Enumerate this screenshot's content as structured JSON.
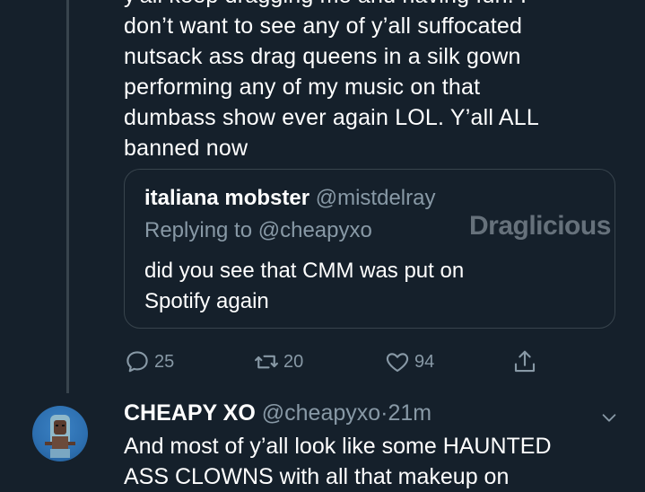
{
  "tweet": {
    "lines": [
      "y'all keep dragging me and having fun. I",
      "don’t want to see any of y’all suffocated",
      "nutsack ass drag queens in a silk gown",
      "performing any of my music on that",
      "dumbass show ever again LOL. Y’all ALL",
      "banned now"
    ],
    "quoted": {
      "name": "italiana mobster",
      "handle": "@mistdelray",
      "replying": "Replying to @cheapyxo",
      "lines": [
        "did you see that CMM was put on",
        "Spotify again"
      ]
    },
    "watermark": "Draglicious",
    "actions": {
      "replies": "25",
      "retweets": "20",
      "likes": "94"
    }
  },
  "tweet2": {
    "name": "CHEAPY XO",
    "handle": "@cheapyxo",
    "separator": "·",
    "time": "21m",
    "lines": [
      "And most of y’all look like some HAUNTED",
      "ASS CLOWNS with all that makeup on "
    ]
  },
  "colors": {
    "background": "#15202b",
    "secondary_text": "#8899a6",
    "border": "#38444d"
  }
}
